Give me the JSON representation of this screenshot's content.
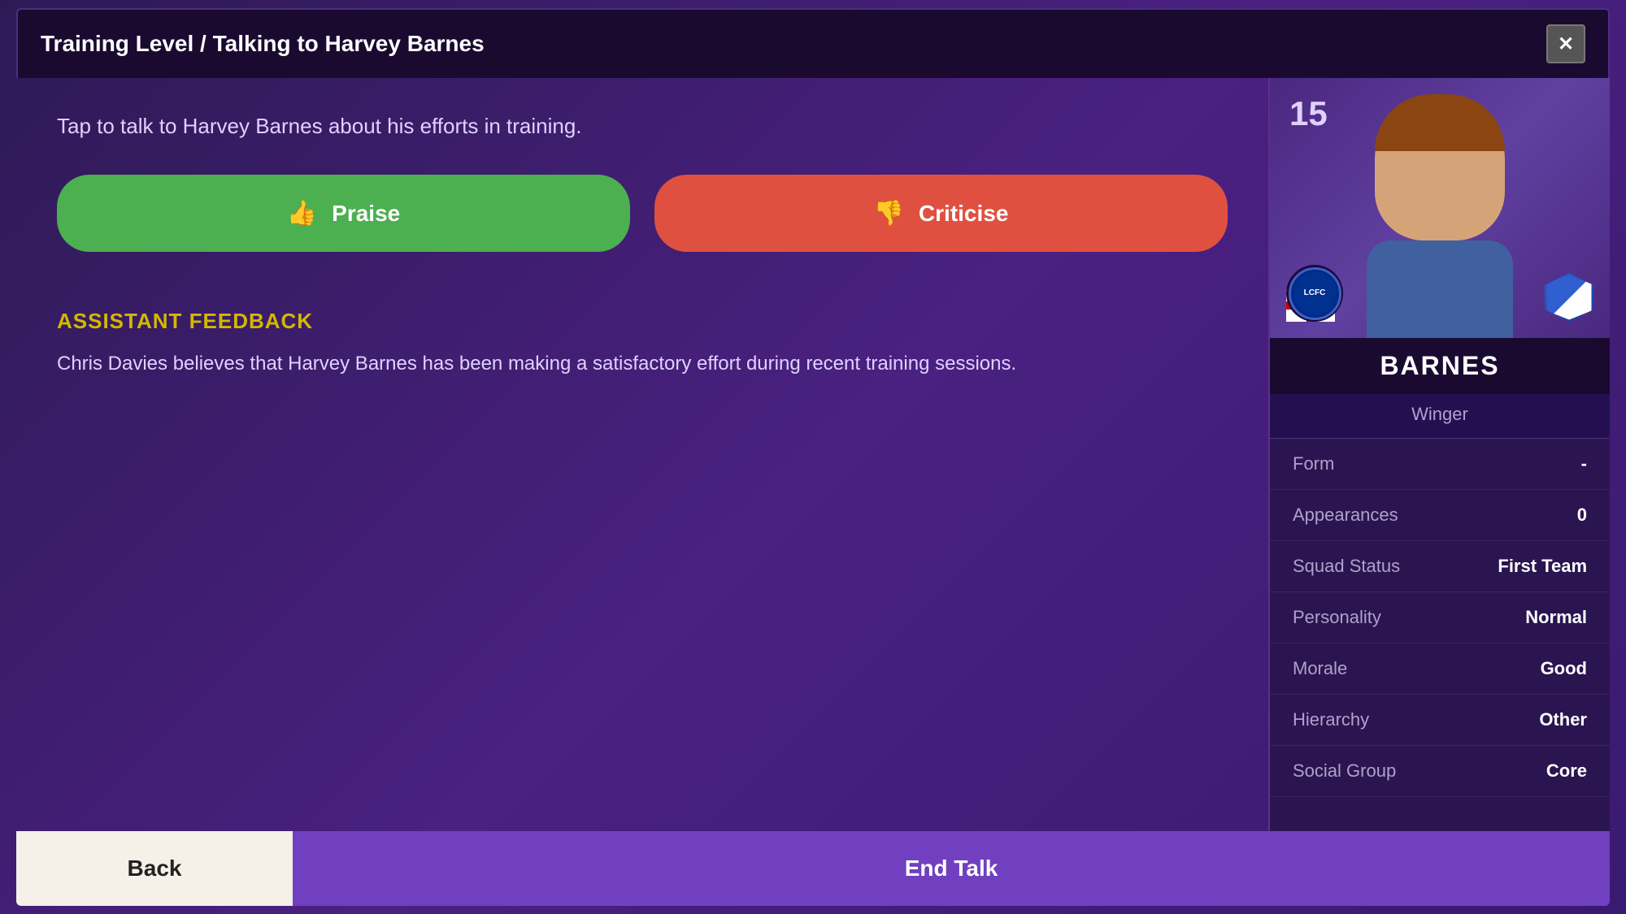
{
  "modal": {
    "title": "Training Level / Talking to Harvey Barnes",
    "instruction": "Tap to talk to Harvey Barnes about his efforts in training.",
    "praise_label": "Praise",
    "criticise_label": "Criticise",
    "assistant_feedback_title": "ASSISTANT FEEDBACK",
    "assistant_feedback_text": "Chris Davies believes that Harvey Barnes has been making a satisfactory effort during recent training sessions.",
    "back_label": "Back",
    "end_talk_label": "End Talk",
    "close_label": "✕"
  },
  "player": {
    "number": "15",
    "name": "BARNES",
    "position": "Winger",
    "form_label": "Form",
    "form_value": "-",
    "appearances_label": "Appearances",
    "appearances_value": "0",
    "squad_status_label": "Squad Status",
    "squad_status_value": "First Team",
    "personality_label": "Personality",
    "personality_value": "Normal",
    "morale_label": "Morale",
    "morale_value": "Good",
    "hierarchy_label": "Hierarchy",
    "hierarchy_value": "Other",
    "social_group_label": "Social Group",
    "social_group_value": "Core"
  },
  "colors": {
    "praise_bg": "#4caf50",
    "criticise_bg": "#e05040",
    "feedback_title": "#d4b800",
    "end_talk_bg": "#7040c0"
  }
}
